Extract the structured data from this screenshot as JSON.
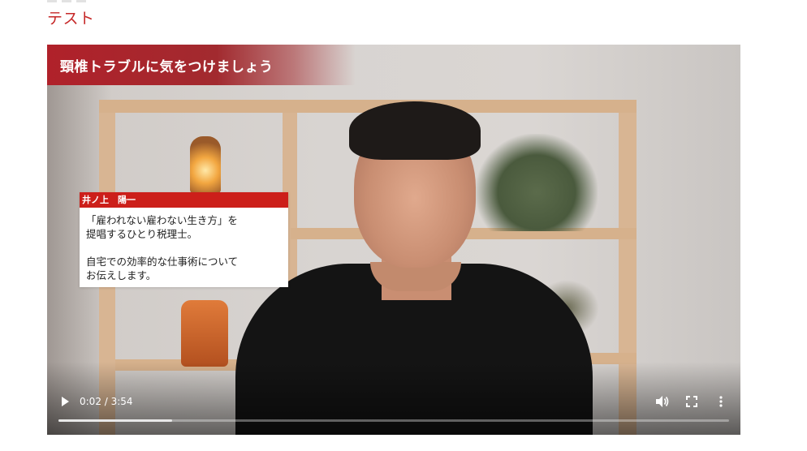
{
  "page": {
    "heading": "テスト"
  },
  "video": {
    "title_overlay": "頸椎トラブルに気をつけましょう",
    "caption": {
      "name": "井ノ上　陽一",
      "line1": "「雇われない雇わない生き方」を",
      "line2": "提唱するひとり税理士。",
      "line3": "自宅での効率的な仕事術について",
      "line4": "お伝えします。"
    },
    "controls": {
      "time": "0:02 / 3:54",
      "progress": 0.17,
      "icons": {
        "play": "play-icon",
        "volume": "volume-icon",
        "fullscreen": "fullscreen-icon",
        "more": "more-vertical-icon"
      }
    }
  },
  "colors": {
    "heading": "#c62828",
    "banner": "#b0212a",
    "name_bar": "#cc1f1a"
  }
}
